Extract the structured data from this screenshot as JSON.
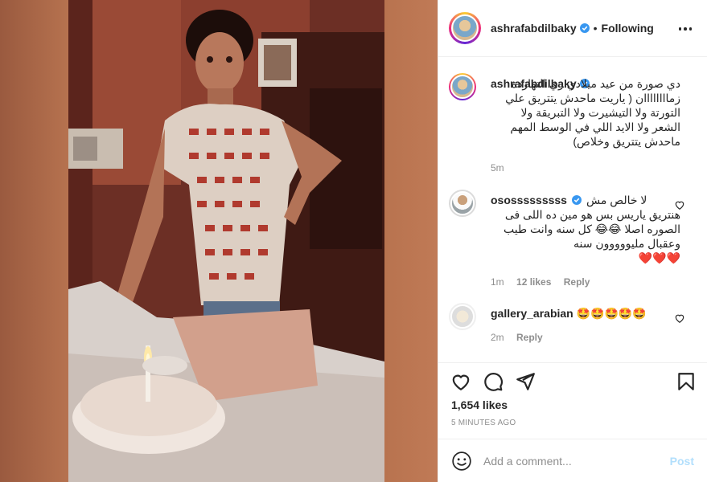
{
  "post": {
    "username": "ashrafabdilbaky",
    "follow_status": "Following",
    "caption": "دي صورة من عيد ميلادي زي النهاردة زماااااااان ( ياريت ماحدش يتتريق علي التورتة ولا التيشيرت ولا التبريقة ولا الشعر ولا الايد اللي في الوسط المهم ماحدش يتتريق وخلاص)",
    "caption_age": "5m",
    "likes": "1,654 likes",
    "timestamp": "5 MINUTES AGO"
  },
  "comments": [
    {
      "username": "ososssssssss",
      "text_line1": "لا خالص مش",
      "text_rest": "هنتريق ياريس بس هو مين ده اللى فى الصوره اصلا 😂😂 كل سنه وانت طيب وعقبال مليووووون سنه",
      "hearts": "❤️❤️❤️",
      "age": "1m",
      "likes": "12 likes",
      "reply": "Reply"
    },
    {
      "username": "gallery_arabian",
      "text": "🤩🤩🤩🤩🤩",
      "age": "2m",
      "reply": "Reply"
    }
  ],
  "composer": {
    "placeholder": "Add a comment...",
    "post_label": "Post"
  },
  "icons": {
    "options": "more-options-icon",
    "like": "heart-icon",
    "comment": "comment-icon",
    "share": "paper-plane-icon",
    "save": "bookmark-icon",
    "emoji": "emoji-icon",
    "verified": "verified-badge-icon"
  },
  "colors": {
    "verified_blue": "#3897f0",
    "muted_text": "#8e8e8e",
    "post_button_disabled": "#b2dffc",
    "photo_bg": "#b06a4e"
  }
}
